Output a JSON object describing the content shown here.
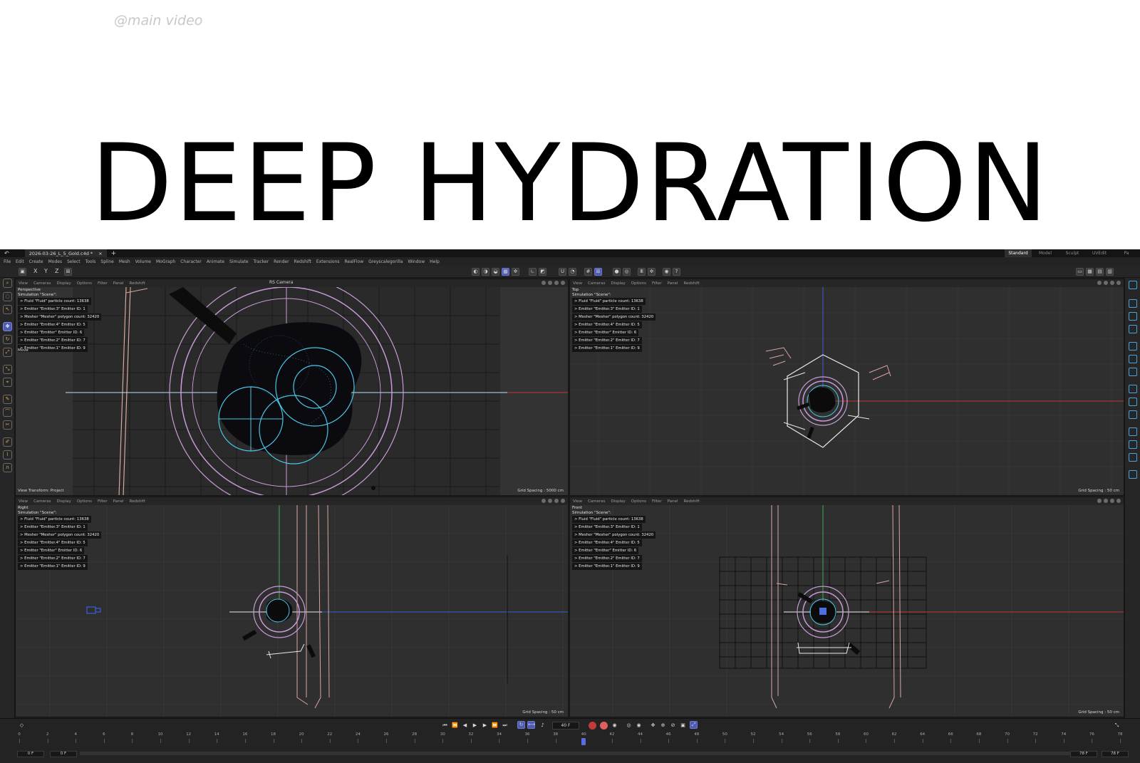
{
  "header": {
    "handle": "@main video",
    "headline": "DEEP HYDRATION"
  },
  "app": {
    "document_tab": "2026-03-26_L_5_Gold.c4d *",
    "layouts": [
      "Standard",
      "Model",
      "Sculpt",
      "UVEdit",
      "Pa"
    ],
    "active_layout": "Standard",
    "menu": [
      "File",
      "Edit",
      "Create",
      "Modes",
      "Select",
      "Tools",
      "Spline",
      "Mesh",
      "Volume",
      "MoGraph",
      "Character",
      "Animate",
      "Simulate",
      "Tracker",
      "Render",
      "Redshift",
      "Extensions",
      "RealFlow",
      "Greyscalegorilla",
      "Window",
      "Help"
    ],
    "axes": [
      "X",
      "Y",
      "Z"
    ],
    "viewport_menu": [
      "View",
      "Cameras",
      "Display",
      "Options",
      "Filter",
      "Panel",
      "Redshift"
    ],
    "simulation_title": "Simulation \"Scene\":",
    "sim_rows": [
      "> Fluid \"Fluid\" particle count: 13638",
      "> Emitter \"Emitter.3\" Emitter ID: 1",
      "> Mesher \"Mesher\" polygon count: 32420",
      "> Emitter \"Emitter.4\" Emitter ID: 5",
      "> Emitter \"Emitter\" Emitter ID: 6",
      "> Emitter \"Emitter.2\" Emitter ID: 7",
      "> Emitter \"Emitter.1\" Emitter ID: 9"
    ],
    "viewports": {
      "perspective": {
        "name": "Perspective",
        "camera": "RS Camera",
        "move": "Move",
        "view_transform": "View Transform: Project",
        "grid_spacing": "Grid Spacing : 5000 cm"
      },
      "top": {
        "name": "Top",
        "grid_spacing": "Grid Spacing : 50 cm"
      },
      "right": {
        "name": "Right",
        "grid_spacing": "Grid Spacing : 50 cm"
      },
      "front": {
        "name": "Front",
        "grid_spacing": "Grid Spacing : 50 cm"
      }
    },
    "timeline": {
      "current_frame": "40 F",
      "start_field": "0 F",
      "start_field2": "0 F",
      "end_field": "78 F",
      "end_field2": "78 F",
      "ticks": [
        0,
        2,
        4,
        6,
        8,
        10,
        12,
        14,
        16,
        18,
        20,
        22,
        24,
        26,
        28,
        30,
        32,
        34,
        36,
        38,
        40,
        42,
        44,
        46,
        48,
        50,
        52,
        54,
        56,
        58,
        60,
        62,
        64,
        66,
        68,
        70,
        72,
        74,
        76,
        78
      ],
      "playhead_frame": 40,
      "max_frame": 78
    },
    "colors": {
      "accent": "#4d5bb5",
      "axis_red": "#c23a3a",
      "axis_green": "#3fae4e",
      "axis_blue": "#3a5fd6",
      "spline_pink": "#d9a6a0",
      "emitter_cyan": "#4cc6e6",
      "circle_violet": "#c99ad7"
    },
    "icons": {
      "undo": "undo-icon",
      "search": "search-icon",
      "move": "move-icon",
      "rotate": "rotate-icon",
      "scale": "scale-icon",
      "camera": "camera-icon"
    }
  }
}
